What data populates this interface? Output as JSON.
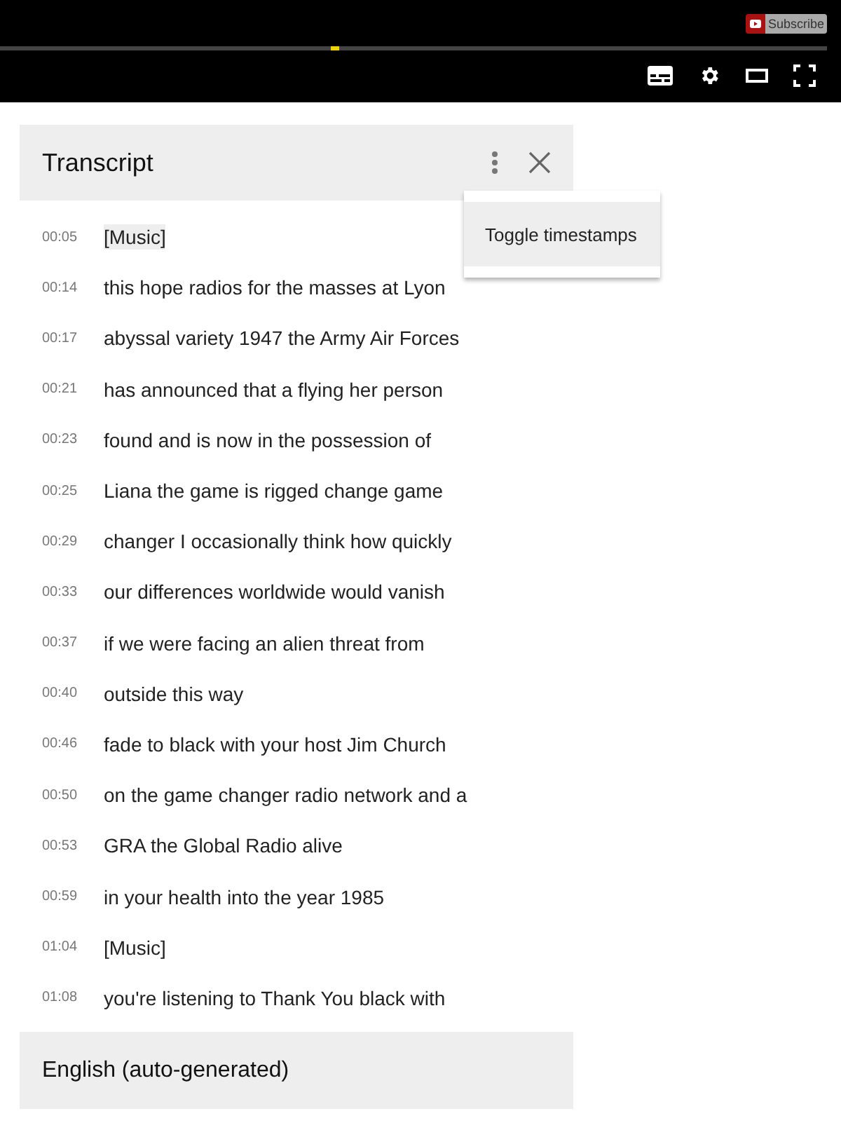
{
  "player": {
    "subscribe": "Subscribe",
    "progress": {
      "level": 0.405
    }
  },
  "transcript": {
    "title": "Transcript",
    "menu": {
      "items": [
        "Toggle timestamps"
      ]
    },
    "lines": [
      {
        "time": "00:05",
        "text": "[Music]",
        "selected": true
      },
      {
        "time": "00:14",
        "text": "this hope radios for the masses at Lyon",
        "selected": false
      },
      {
        "time": "00:17",
        "text": "abyssal variety 1947 the Army Air Forces",
        "selected": false
      },
      {
        "time": "00:21",
        "text": "has announced that a flying her person",
        "selected": false
      },
      {
        "time": "00:23",
        "text": "found and is now in the possession of",
        "selected": false
      },
      {
        "time": "00:25",
        "text": "Liana the game is rigged change game",
        "selected": false
      },
      {
        "time": "00:29",
        "text": "changer I occasionally think how quickly",
        "selected": false
      },
      {
        "time": "00:33",
        "text": "our differences worldwide would vanish",
        "selected": false
      },
      {
        "time": "00:37",
        "text": "if we were facing an alien threat from",
        "selected": false
      },
      {
        "time": "00:40",
        "text": "outside this way",
        "selected": false
      },
      {
        "time": "00:46",
        "text": "fade to black with your host Jim Church",
        "selected": false
      },
      {
        "time": "00:50",
        "text": "on the game changer radio network and a",
        "selected": false
      },
      {
        "time": "00:53",
        "text": "GRA the Global Radio alive",
        "selected": false
      },
      {
        "time": "00:59",
        "text": "in your health into the year 1985",
        "selected": false
      },
      {
        "time": "01:04",
        "text": "[Music]",
        "selected": false
      },
      {
        "time": "01:08",
        "text": "you're listening to Thank You black with",
        "selected": false
      }
    ],
    "language": "English (auto-generated)"
  }
}
